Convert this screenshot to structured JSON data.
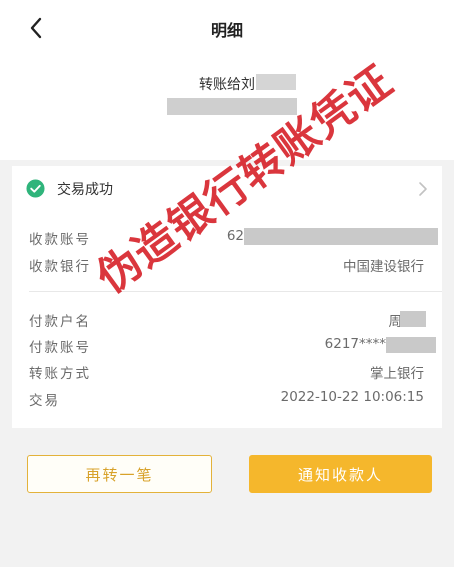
{
  "header": {
    "title": "明细",
    "back_icon": "chevron-left-icon"
  },
  "summary": {
    "transfer_title": "转账给刘"
  },
  "status": {
    "text": "交易成功",
    "icon": "check-circle-icon",
    "color": "#2fb47b"
  },
  "details": {
    "payee_account_label": "收款账号",
    "payee_account_value": "62",
    "payee_bank_label": "收款银行",
    "payee_bank_value": "中国建设银行",
    "payer_name_label": "付款户名",
    "payer_name_value": "周",
    "payer_account_label": "付款账号",
    "payer_account_value": "6217****",
    "method_label": "转账方式",
    "method_value": "掌上银行",
    "time_label": "交易",
    "time_value": "2022-10-22 10:06:15"
  },
  "buttons": {
    "again_label": "再转一笔",
    "notify_label": "通知收款人"
  },
  "watermark": {
    "text": "伪造银行转账凭证",
    "color": "#d4141c"
  }
}
